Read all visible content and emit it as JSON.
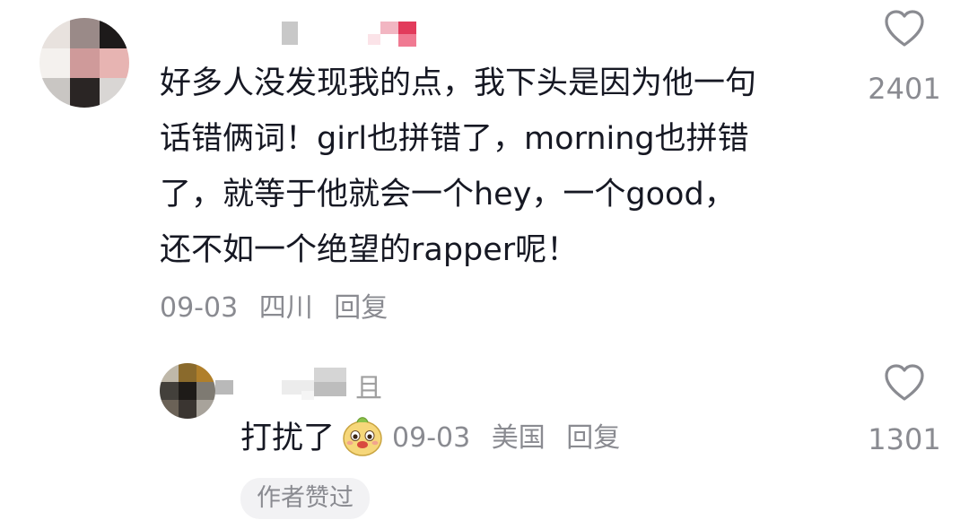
{
  "comments": [
    {
      "text_lines": [
        "好多人没发现我的点，我下头是因为他一句",
        "话错俩词！girl也拼错了，morning也拼错",
        "了，就等于他就会一个hey，一个good，",
        "还不如一个绝望的rapper呢！"
      ],
      "date": "09-03",
      "location": "四川",
      "reply_label": "回复",
      "likes": "2401"
    },
    {
      "text": "打扰了",
      "date": "09-03",
      "location": "美国",
      "reply_label": "回复",
      "likes": "1301",
      "author_liked_label": "作者赞过",
      "name_fragment": "且"
    }
  ],
  "icons": {
    "like": "heart-outline-icon",
    "emoji": "face-emoji-icon"
  },
  "colors": {
    "text": "#161823",
    "meta": "#8a8b91",
    "pill_bg": "#f2f2f4"
  }
}
